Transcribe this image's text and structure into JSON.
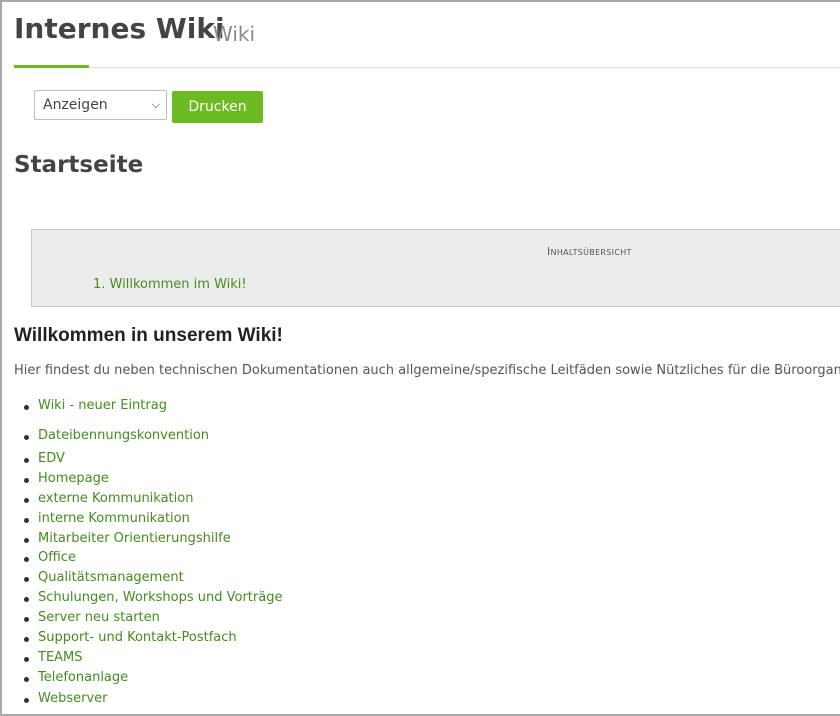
{
  "header": {
    "title": "Internes Wiki",
    "subtitle": "Wiki"
  },
  "toolbar": {
    "view_select_value": "Anzeigen",
    "print_label": "Drucken",
    "colors": {
      "accent": "#6dbb22",
      "link": "#448c1e"
    }
  },
  "page": {
    "title": "Startseite"
  },
  "toc": {
    "title": "Inhaltsübersicht",
    "items": [
      {
        "number": "1.",
        "label": "Willkommen im Wiki!"
      }
    ]
  },
  "content": {
    "heading": "Willkommen in unserem Wiki!",
    "intro": "Hier findest du neben technischen Dokumentationen auch allgemeine/spezifische Leitfäden sowie Nützliches für die Büroorganisation.",
    "links": [
      "Wiki - neuer Eintrag",
      "Dateibennungskonvention",
      "EDV",
      "Homepage",
      "externe Kommunikation",
      "interne Kommunikation",
      "Mitarbeiter Orientierungshilfe",
      "Office",
      "Qualitätsmanagement",
      "Schulungen, Workshops und Vorträge",
      "Server neu starten",
      "Support- und Kontakt-Postfach",
      "TEAMS",
      "Telefonanlage",
      "Webserver"
    ]
  }
}
